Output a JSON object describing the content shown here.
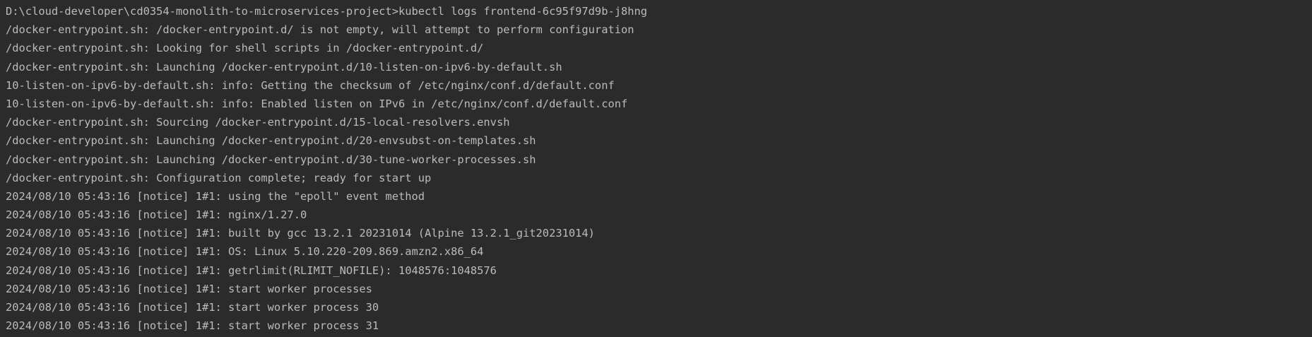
{
  "terminal": {
    "command_line": "D:\\cloud-developer\\cd0354-monolith-to-microservices-project>kubectl logs frontend-6c95f97d9b-j8hng",
    "lines": [
      "/docker-entrypoint.sh: /docker-entrypoint.d/ is not empty, will attempt to perform configuration",
      "/docker-entrypoint.sh: Looking for shell scripts in /docker-entrypoint.d/",
      "/docker-entrypoint.sh: Launching /docker-entrypoint.d/10-listen-on-ipv6-by-default.sh",
      "10-listen-on-ipv6-by-default.sh: info: Getting the checksum of /etc/nginx/conf.d/default.conf",
      "10-listen-on-ipv6-by-default.sh: info: Enabled listen on IPv6 in /etc/nginx/conf.d/default.conf",
      "/docker-entrypoint.sh: Sourcing /docker-entrypoint.d/15-local-resolvers.envsh",
      "/docker-entrypoint.sh: Launching /docker-entrypoint.d/20-envsubst-on-templates.sh",
      "/docker-entrypoint.sh: Launching /docker-entrypoint.d/30-tune-worker-processes.sh",
      "/docker-entrypoint.sh: Configuration complete; ready for start up",
      "2024/08/10 05:43:16 [notice] 1#1: using the \"epoll\" event method",
      "2024/08/10 05:43:16 [notice] 1#1: nginx/1.27.0",
      "2024/08/10 05:43:16 [notice] 1#1: built by gcc 13.2.1 20231014 (Alpine 13.2.1_git20231014)",
      "2024/08/10 05:43:16 [notice] 1#1: OS: Linux 5.10.220-209.869.amzn2.x86_64",
      "2024/08/10 05:43:16 [notice] 1#1: getrlimit(RLIMIT_NOFILE): 1048576:1048576",
      "2024/08/10 05:43:16 [notice] 1#1: start worker processes",
      "2024/08/10 05:43:16 [notice] 1#1: start worker process 30",
      "2024/08/10 05:43:16 [notice] 1#1: start worker process 31"
    ],
    "colors": {
      "background": "#2b2b2b",
      "text": "#bbbbbb"
    }
  }
}
